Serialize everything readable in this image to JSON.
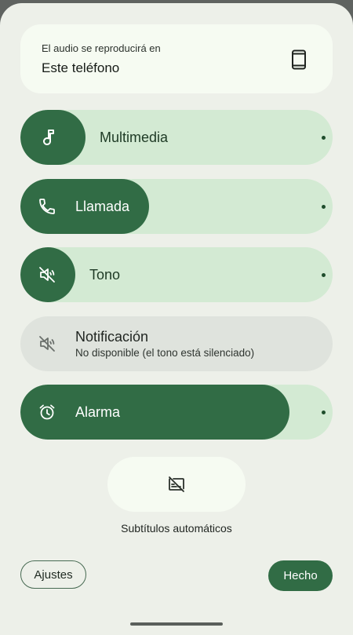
{
  "output": {
    "caption": "El audio se reproducirá en",
    "device": "Este teléfono",
    "icon": "smartphone-icon"
  },
  "sliders": [
    {
      "label": "Multimedia",
      "icon": "music-note-icon",
      "level": 0
    },
    {
      "label": "Llamada",
      "icon": "phone-icon",
      "level": 0.32
    },
    {
      "label": "Tono",
      "icon": "volume-off-icon",
      "level": 0
    },
    {
      "label": "Alarma",
      "icon": "alarm-icon",
      "level": 0.82
    }
  ],
  "notification": {
    "label": "Notificación",
    "status": "No disponible (el tono está silenciado)",
    "icon": "volume-off-icon"
  },
  "captions": {
    "label": "Subtítulos automáticos",
    "icon": "captions-off-icon"
  },
  "footer": {
    "settings_label": "Ajustes",
    "done_label": "Hecho"
  },
  "colors": {
    "accent": "#316c45",
    "track": "#d3ead3",
    "background": "#edf0e9"
  }
}
